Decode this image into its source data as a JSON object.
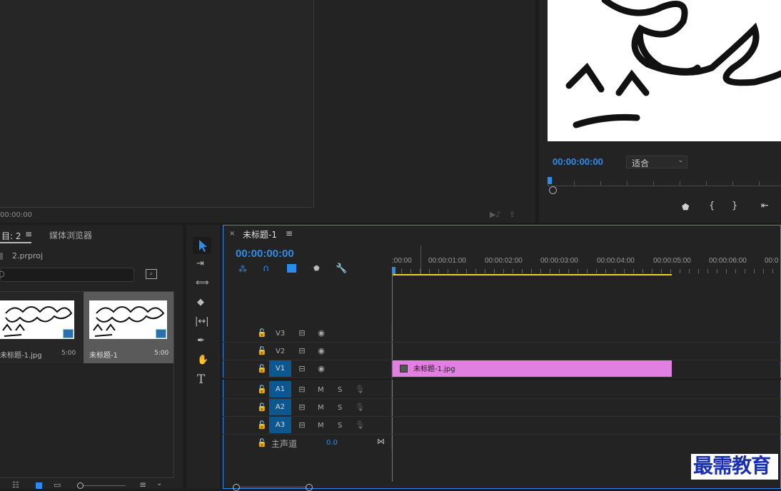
{
  "source_monitor": {
    "timecode": "00:00:00"
  },
  "program_monitor": {
    "timecode": "00:00:00:00",
    "fit_label": "适合",
    "markers": [
      "{",
      "}"
    ]
  },
  "project_panel": {
    "tab_project": "目: 2",
    "tab_media_browser": "媒体浏览器",
    "project_file": "2.prproj",
    "items": [
      {
        "name": "未标题-1.jpg",
        "duration": "5:00"
      },
      {
        "name": "未标题-1",
        "duration": "5:00"
      }
    ]
  },
  "timeline": {
    "tab_title": "未标题-1",
    "timecode": "00:00:00:00",
    "ruler_labels": [
      ":00:00",
      "00:00:01:00",
      "00:00:02:00",
      "00:00:03:00",
      "00:00:04:00",
      "00:00:05:00",
      "00:00:06:00",
      "00:0"
    ],
    "video_tracks": [
      "V3",
      "V2",
      "V1"
    ],
    "audio_tracks": [
      "A1",
      "A2",
      "A3"
    ],
    "master_label": "主声道",
    "master_value": "0.0",
    "clip_name": "未标题-1.jpg",
    "mute_label": "M",
    "solo_label": "S",
    "clip_color": "#e080e0",
    "accent": "#2d8ceb"
  },
  "tools": [
    "selection-tool",
    "track-select-tool",
    "ripple-edit-tool",
    "razor-tool",
    "slip-tool",
    "pen-tool",
    "hand-tool",
    "type-tool"
  ],
  "tool_type_glyph": "T",
  "watermark": "最需教育"
}
